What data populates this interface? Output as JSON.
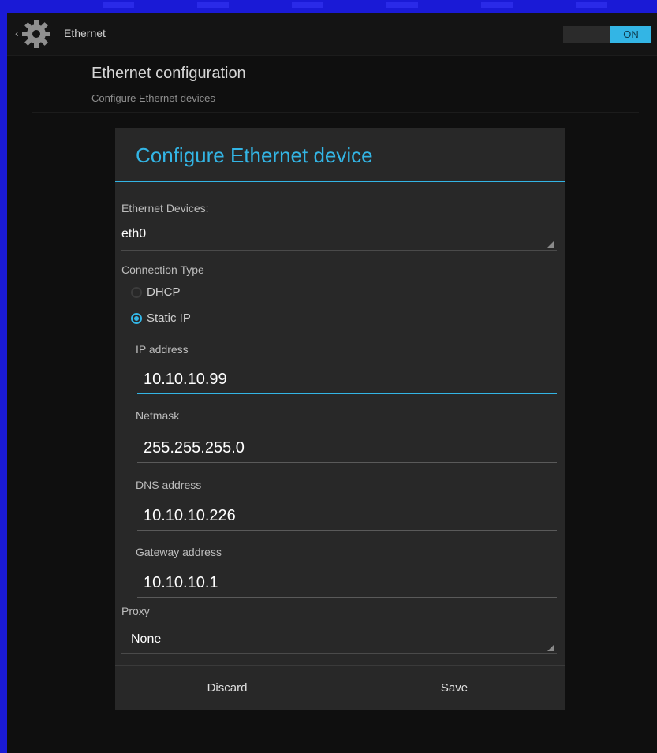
{
  "action_bar": {
    "title": "Ethernet",
    "switch_label": "ON"
  },
  "header": {
    "title": "Ethernet configuration",
    "subtitle": "Configure Ethernet devices"
  },
  "dialog": {
    "title": "Configure Ethernet device",
    "devices_label": "Ethernet Devices:",
    "device_value": "eth0",
    "connection_type_label": "Connection Type",
    "option_dhcp": "DHCP",
    "option_static": "Static IP",
    "ip_label": "IP address",
    "ip_value": "10.10.10.99",
    "netmask_label": "Netmask",
    "netmask_value": "255.255.255.0",
    "dns_label": "DNS address",
    "dns_value": "10.10.10.226",
    "gateway_label": "Gateway address",
    "gateway_value": "10.10.10.1",
    "proxy_label": "Proxy",
    "proxy_value": "None",
    "discard_label": "Discard",
    "save_label": "Save"
  },
  "colors": {
    "accent": "#33b5e5",
    "dialog_bg": "#282828",
    "frame_blue": "#1a1ad6"
  },
  "icons": [
    "settings-gear-icon",
    "up-caret-icon",
    "spinner-arrow-icon"
  ]
}
